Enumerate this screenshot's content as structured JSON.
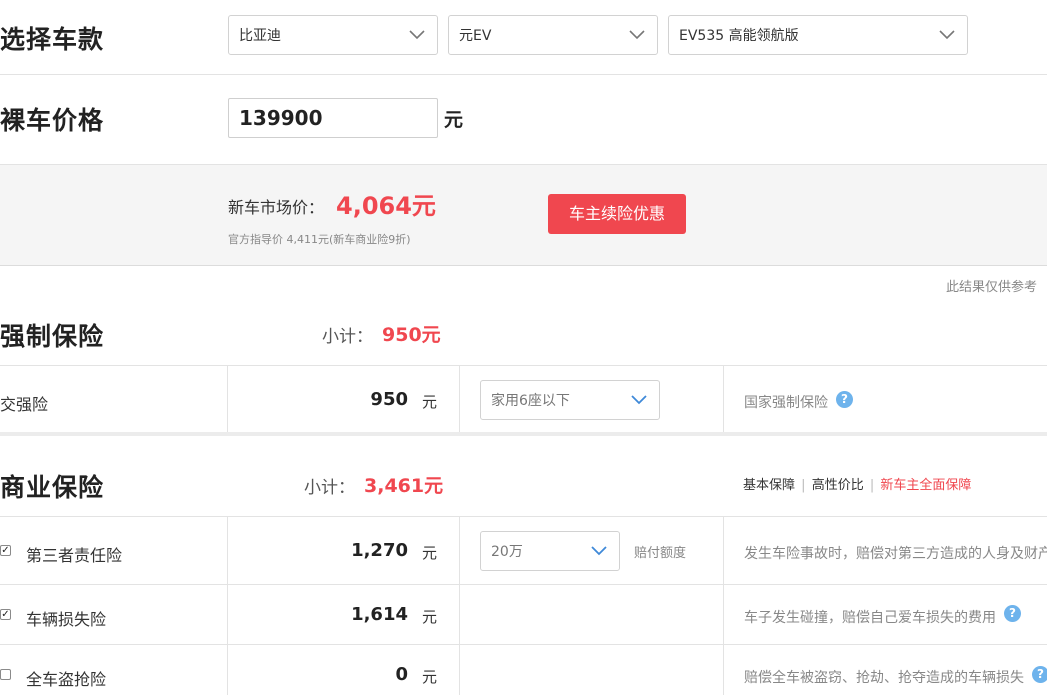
{
  "select_model": {
    "title": "选择车款",
    "brand": "比亚迪",
    "series": "元EV",
    "trim": "EV535 高能领航版"
  },
  "bare_price": {
    "title": "裸车价格",
    "value": "139900",
    "unit": "元"
  },
  "market": {
    "label": "新车市场价：",
    "value": "4,064元",
    "guide_text": "官方指导价 4,411元(新车商业险9折)",
    "button": "车主续险优惠"
  },
  "disclaimer": "此结果仅供参考",
  "compulsory": {
    "title": "强制保险",
    "subtotal_label": "小计：",
    "subtotal_value": "950元",
    "rows": [
      {
        "label": "交强险",
        "amount": "950",
        "unit": "元",
        "option": "家用6座以下",
        "desc": "国家强制保险"
      }
    ]
  },
  "commercial": {
    "title": "商业保险",
    "subtotal_label": "小计：",
    "subtotal_value": "3,461元",
    "plans": [
      "基本保障",
      "高性价比",
      "新车主全面保障"
    ],
    "plan_separator": "|",
    "rows": [
      {
        "label": "第三者责任险",
        "checked": true,
        "amount": "1,270",
        "unit": "元",
        "option": "20万",
        "option_label": "赔付额度",
        "desc": "发生车险事故时，赔偿对第三方造成的人身及财产"
      },
      {
        "label": "车辆损失险",
        "checked": true,
        "amount": "1,614",
        "unit": "元",
        "desc": "车子发生碰撞，赔偿自己爱车损失的费用"
      },
      {
        "label": "全车盗抢险",
        "checked": false,
        "amount": "0",
        "unit": "元",
        "desc": "赔偿全车被盗窃、抢劫、抢夺造成的车辆损失"
      }
    ]
  },
  "colors": {
    "accent_red": "#f0474f",
    "help_blue": "#6eb3ec",
    "band_grey": "#f5f5f5"
  },
  "icons": {
    "dropdown": "chevron-down-icon",
    "help": "question-circle-icon",
    "check": "checkbox-icon"
  }
}
